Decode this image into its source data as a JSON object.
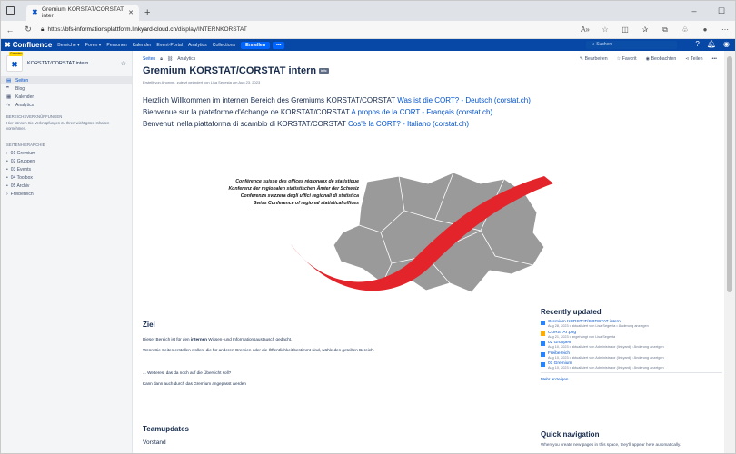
{
  "browser": {
    "tab_title": "Gremium KORSTAT/CORSTAT inter",
    "url_host": "bfs-informationsplattform.linkyard-cloud.ch",
    "url_path": "/display/INTERNKORSTAT",
    "url_prefix": "https://"
  },
  "topnav": {
    "brand": "Confluence",
    "menu": [
      "Bereiche ▾",
      "Foren ▾",
      "Personen",
      "Kalender",
      "Event-Portal",
      "Analytics",
      "Collections"
    ],
    "create": "Erstellen",
    "more": "•••",
    "search_placeholder": "Suchen"
  },
  "sidebar": {
    "space_badge": "Gremien",
    "space_name": "KORSTAT/CORSTAT intern",
    "items": [
      {
        "label": "Seiten",
        "icon": "▤"
      },
      {
        "label": "Blog",
        "icon": "❞"
      },
      {
        "label": "Kalender",
        "icon": "▦"
      },
      {
        "label": "Analytics",
        "icon": "∿"
      }
    ],
    "links_header": "BEREICHSVERKNÜPFUNGEN",
    "links_text": "Hier können Sie Verknüpfungen zu Ihren wichtigsten Inhalten vornehmen.",
    "tree_header": "SEITENHIERARCHIE",
    "tree": [
      {
        "arrow": "›",
        "label": "01 Gremium"
      },
      {
        "arrow": "•",
        "label": "02 Gruppen"
      },
      {
        "arrow": "•",
        "label": "03 Events"
      },
      {
        "arrow": "•",
        "label": "04 Toolbox"
      },
      {
        "arrow": "•",
        "label": "05 Archiv"
      },
      {
        "arrow": "›",
        "label": "Freibereich"
      }
    ]
  },
  "page": {
    "crumb_seiten": "Seiten",
    "crumb_analytics": "Analytics",
    "actions": [
      "Bearbeiten",
      "Favorit",
      "Beobachten",
      "Teilen",
      "•••"
    ],
    "title": "Gremium KORSTAT/CORSTAT intern",
    "title_tag": "info",
    "byline": "Erstellt von Anonym, zuletzt geändert von Lisa Segesta am Aug 23, 2023",
    "welcome": [
      {
        "text": "Herzlich Willkommen im internen Bereich des Gremiums KORSTAT/CORSTAT ",
        "link": "Was ist die CORT? - Deutsch (corstat.ch)"
      },
      {
        "text": "Bienvenue sur la plateforme d'échange de KORSTAT/CORSTAT ",
        "link": "A propos de la CORT - Français (corstat.ch)"
      },
      {
        "text": "Benvenuti nella piattaforma di scambio di KORSTAT/CORSTAT ",
        "link": "Cos'è la CORT? - Italiano (corstat.ch)"
      }
    ],
    "figure_lines": [
      "Conférence suisse des offices régionaux de statistique",
      "Konferenz der regionalen statistischen Ämter der Schweiz",
      "Conferenza svizzera degli uffici regionali di statistica",
      "Swiss Conference of regional statistical offices"
    ],
    "ziel_heading": "Ziel",
    "ziel_p1_a": "Dieser Bereich ist für den ",
    "ziel_p1_b": "internen",
    "ziel_p1_c": " Wissen- und Informationsaustausch gedacht.",
    "ziel_p2": "Wenn Sie Seiten erstellen wollen, die für anderen Gremien oder die Öffentlichkeit bestimmt sind, wähle den geteilten Bereich.",
    "ziel_p3": "... Weiteres, das da noch auf die Übersicht soll?",
    "ziel_p4": "Kann dann auch durch das Gremium angepasst werden",
    "team_heading": "Teamupdates",
    "team_sub": "Vorstand"
  },
  "recent": {
    "heading": "Recently updated",
    "items": [
      {
        "title": "Gremium KORSTAT/CORSTAT intern",
        "meta": "Aug 28, 2023 • aktualisiert von Lisa Segesta • Änderung anzeigen",
        "type": "page"
      },
      {
        "title": "CORSTAT.png",
        "meta": "Aug 21, 2023 • angehängt von Lisa Segesta",
        "type": "image"
      },
      {
        "title": "02 Gruppen",
        "meta": "Aug 10, 2023 • aktualisiert von Administrator (linkyard) • Änderung anzeigen",
        "type": "page"
      },
      {
        "title": "Freibereich",
        "meta": "Aug 10, 2023 • aktualisiert von Administrator (linkyard) • Änderung anzeigen",
        "type": "page"
      },
      {
        "title": "01 Gremium",
        "meta": "Aug 10, 2023 • aktualisiert von Administrator (linkyard) • Änderung anzeigen",
        "type": "page"
      }
    ],
    "more": "Mehr anzeigen"
  },
  "quicknav": {
    "heading": "Quick navigation",
    "text": "When you create new pages in this space, they'll appear here automatically."
  }
}
